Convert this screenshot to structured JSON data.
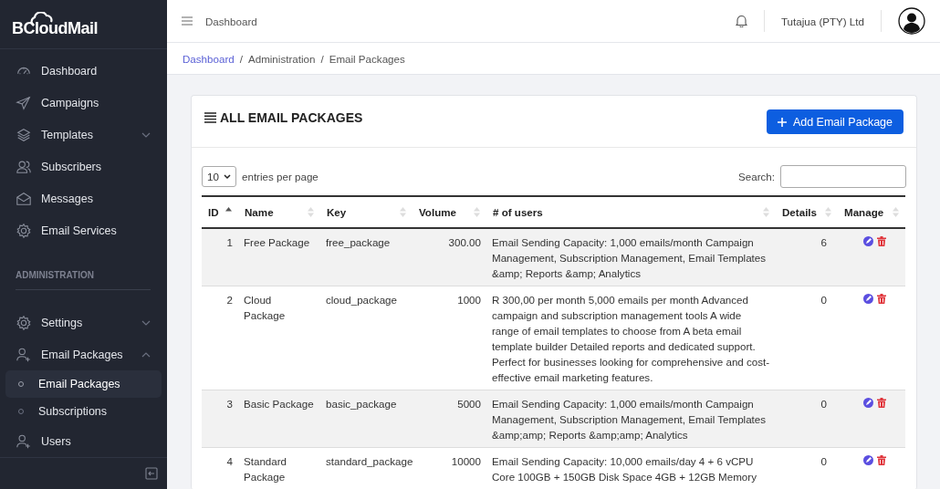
{
  "sidebar": {
    "logo": "BCloudMail",
    "items": [
      {
        "label": "Dashboard"
      },
      {
        "label": "Campaigns"
      },
      {
        "label": "Templates",
        "expanded": false
      },
      {
        "label": "Subscribers"
      },
      {
        "label": "Messages"
      },
      {
        "label": "Email Services"
      }
    ],
    "section": "ADMINISTRATION",
    "admin_items": [
      {
        "label": "Settings",
        "expanded": false
      },
      {
        "label": "Email Packages",
        "expanded": true,
        "children": [
          {
            "label": "Email Packages",
            "selected": true
          },
          {
            "label": "Subscriptions",
            "selected": false
          }
        ]
      },
      {
        "label": "Users"
      }
    ]
  },
  "topbar": {
    "title": "Dashboard",
    "company": "Tutajua (PTY) Ltd"
  },
  "breadcrumb": {
    "items": [
      "Dashboard",
      "Administration",
      "Email Packages"
    ],
    "separators": [
      "/",
      "/"
    ]
  },
  "card": {
    "title": "ALL EMAIL PACKAGES",
    "add_button": "Add Email Package",
    "page_size": "10",
    "page_size_label": "entries per page",
    "search_label": "Search:",
    "columns": [
      {
        "label": "ID",
        "sorted": true
      },
      {
        "label": "Name",
        "sorted": false
      },
      {
        "label": "Key",
        "sorted": false
      },
      {
        "label": "Volume",
        "sorted": false
      },
      {
        "label": "# of users",
        "sorted": false
      },
      {
        "label": "Details",
        "sorted": false
      },
      {
        "label": "Manage",
        "sorted": false
      }
    ],
    "rows": [
      {
        "id": "1",
        "name": "Free Package",
        "key": "free_package",
        "volume": "300.00",
        "users": "Email Sending Capacity: 1,000 emails/month Campaign Management, Subscription Management, Email Templates &amp; Reports &amp; Analytics",
        "details": "6"
      },
      {
        "id": "2",
        "name": "Cloud Package",
        "key": "cloud_package",
        "volume": "1000",
        "users": "R 300,00 per month 5,000 emails per month Advanced campaign and subscription management tools A wide range of email templates to choose from A beta email template builder Detailed reports and dedicated support. Perfect for businesses looking for comprehensive and cost-effective email marketing features.",
        "details": "0"
      },
      {
        "id": "3",
        "name": "Basic Package",
        "key": "basic_package",
        "volume": "5000",
        "users": "Email Sending Capacity: 1,000 emails/month Campaign Management, Subscription Management, Email Templates &amp;amp; Reports &amp;amp; Analytics",
        "details": "0"
      },
      {
        "id": "4",
        "name": "Standard Package",
        "key": "standard_package",
        "volume": "10000",
        "users": "Email Sending Capacity: 10,000 emails/day 4 + 6 vCPU Core 100GB + 150GB Disk Space 4GB + 12GB Memory",
        "details": "0"
      }
    ]
  }
}
